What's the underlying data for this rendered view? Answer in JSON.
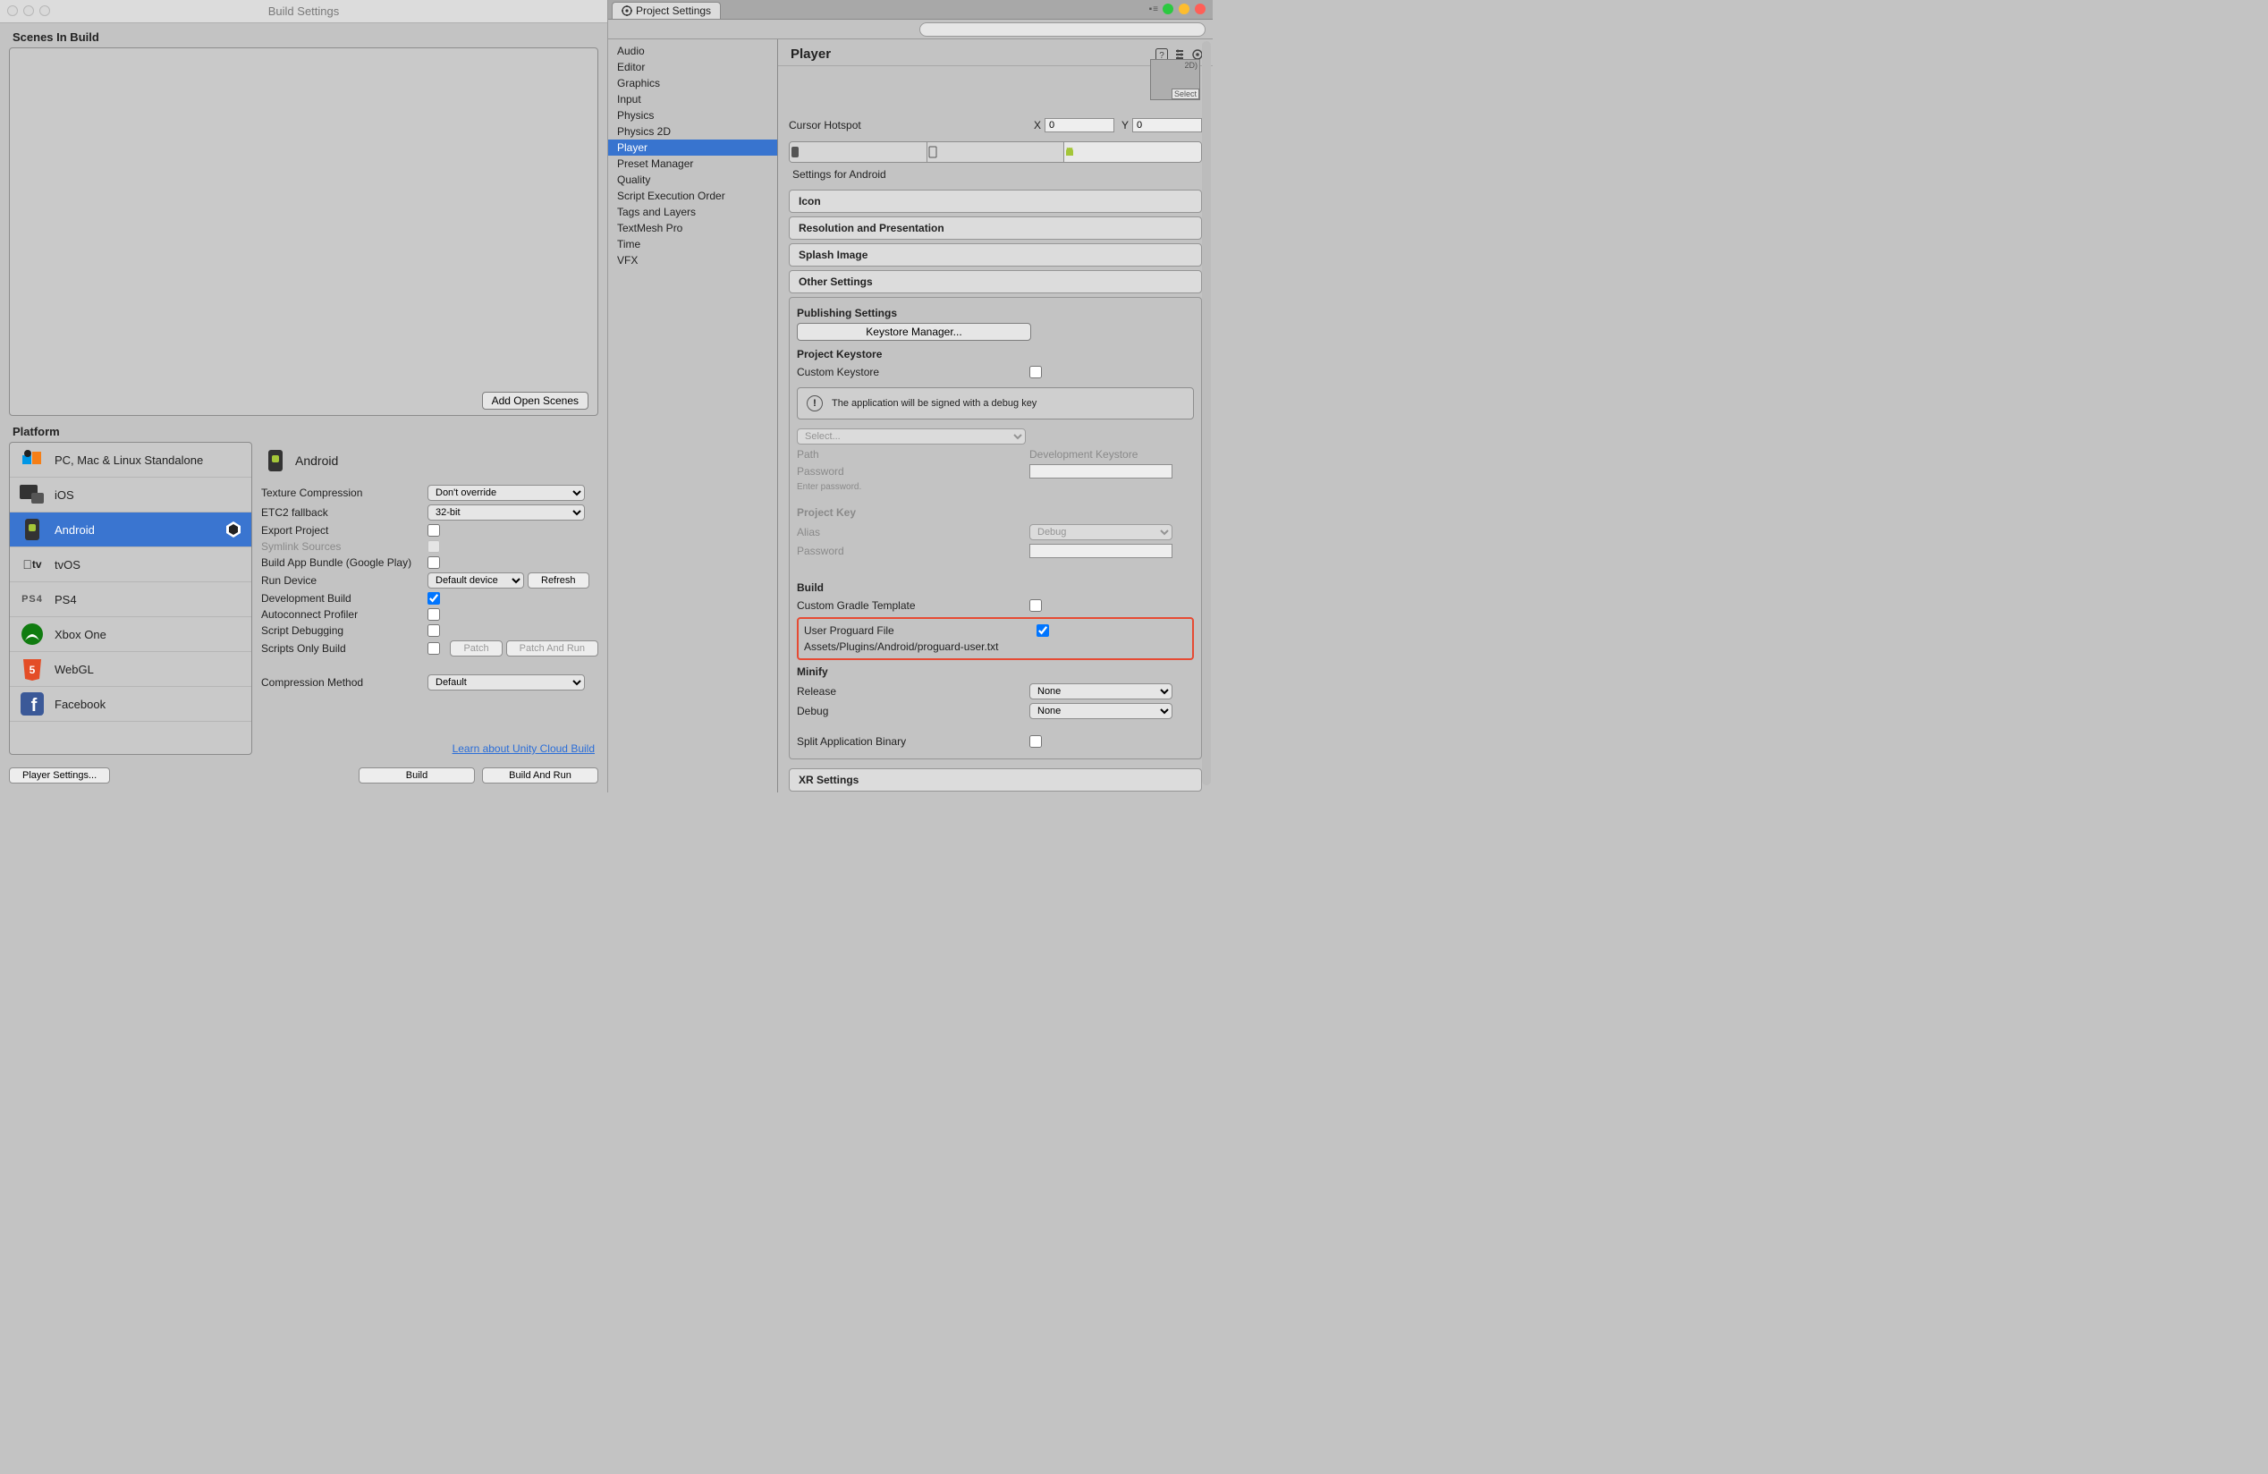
{
  "build_settings": {
    "window_title": "Build Settings",
    "scenes_header": "Scenes In Build",
    "add_open_scenes": "Add Open Scenes",
    "platform_label": "Platform",
    "platforms": [
      "PC, Mac & Linux Standalone",
      "iOS",
      "Android",
      "tvOS",
      "PS4",
      "Xbox One",
      "WebGL",
      "Facebook"
    ],
    "selected_platform_index": 2,
    "right_title": "Android",
    "options": {
      "texture_compression_label": "Texture Compression",
      "texture_compression_value": "Don't override",
      "etc2_label": "ETC2 fallback",
      "etc2_value": "32-bit",
      "export_project": "Export Project",
      "symlink_sources": "Symlink Sources",
      "build_app_bundle": "Build App Bundle (Google Play)",
      "run_device_label": "Run Device",
      "run_device_value": "Default device",
      "refresh": "Refresh",
      "dev_build": "Development Build",
      "autoconnect": "Autoconnect Profiler",
      "script_debug": "Script Debugging",
      "scripts_only": "Scripts Only Build",
      "patch": "Patch",
      "patch_run": "Patch And Run",
      "compression_method_label": "Compression Method",
      "compression_method_value": "Default"
    },
    "cloud_link": "Learn about Unity Cloud Build",
    "player_settings_btn": "Player Settings...",
    "build_btn": "Build",
    "build_run_btn": "Build And Run"
  },
  "project_settings": {
    "tab_title": "Project Settings",
    "search_placeholder": "",
    "categories": [
      "Audio",
      "Editor",
      "Graphics",
      "Input",
      "Physics",
      "Physics 2D",
      "Player",
      "Preset Manager",
      "Quality",
      "Script Execution Order",
      "Tags and Layers",
      "TextMesh Pro",
      "Time",
      "VFX"
    ],
    "selected_category_index": 6,
    "player": {
      "title": "Player",
      "icon_preview_top": "2D)",
      "icon_preview_select": "Select",
      "cursor_hotspot_label": "Cursor Hotspot",
      "cursor_x_label": "X",
      "cursor_x": "0",
      "cursor_y_label": "Y",
      "cursor_y": "0",
      "settings_for": "Settings for Android",
      "sections": {
        "icon": "Icon",
        "resolution": "Resolution and Presentation",
        "splash": "Splash Image",
        "other": "Other Settings",
        "publishing": "Publishing Settings",
        "xr": "XR Settings"
      },
      "publishing": {
        "keystore_manager": "Keystore Manager...",
        "project_keystore": "Project Keystore",
        "custom_keystore": "Custom Keystore",
        "debug_msg": "The application will be signed with a debug key",
        "select": "Select...",
        "path_label": "Path",
        "path_value": "Development Keystore",
        "password_label": "Password",
        "enter_password": "Enter password.",
        "project_key": "Project Key",
        "alias_label": "Alias",
        "alias_value": "Debug",
        "key_password_label": "Password",
        "build_header": "Build",
        "custom_gradle": "Custom Gradle Template",
        "user_proguard": "User Proguard File",
        "proguard_path": "Assets/Plugins/Android/proguard-user.txt",
        "minify_header": "Minify",
        "release_label": "Release",
        "release_value": "None",
        "debug_label": "Debug",
        "debug_value": "None",
        "split_binary": "Split Application Binary"
      }
    }
  }
}
